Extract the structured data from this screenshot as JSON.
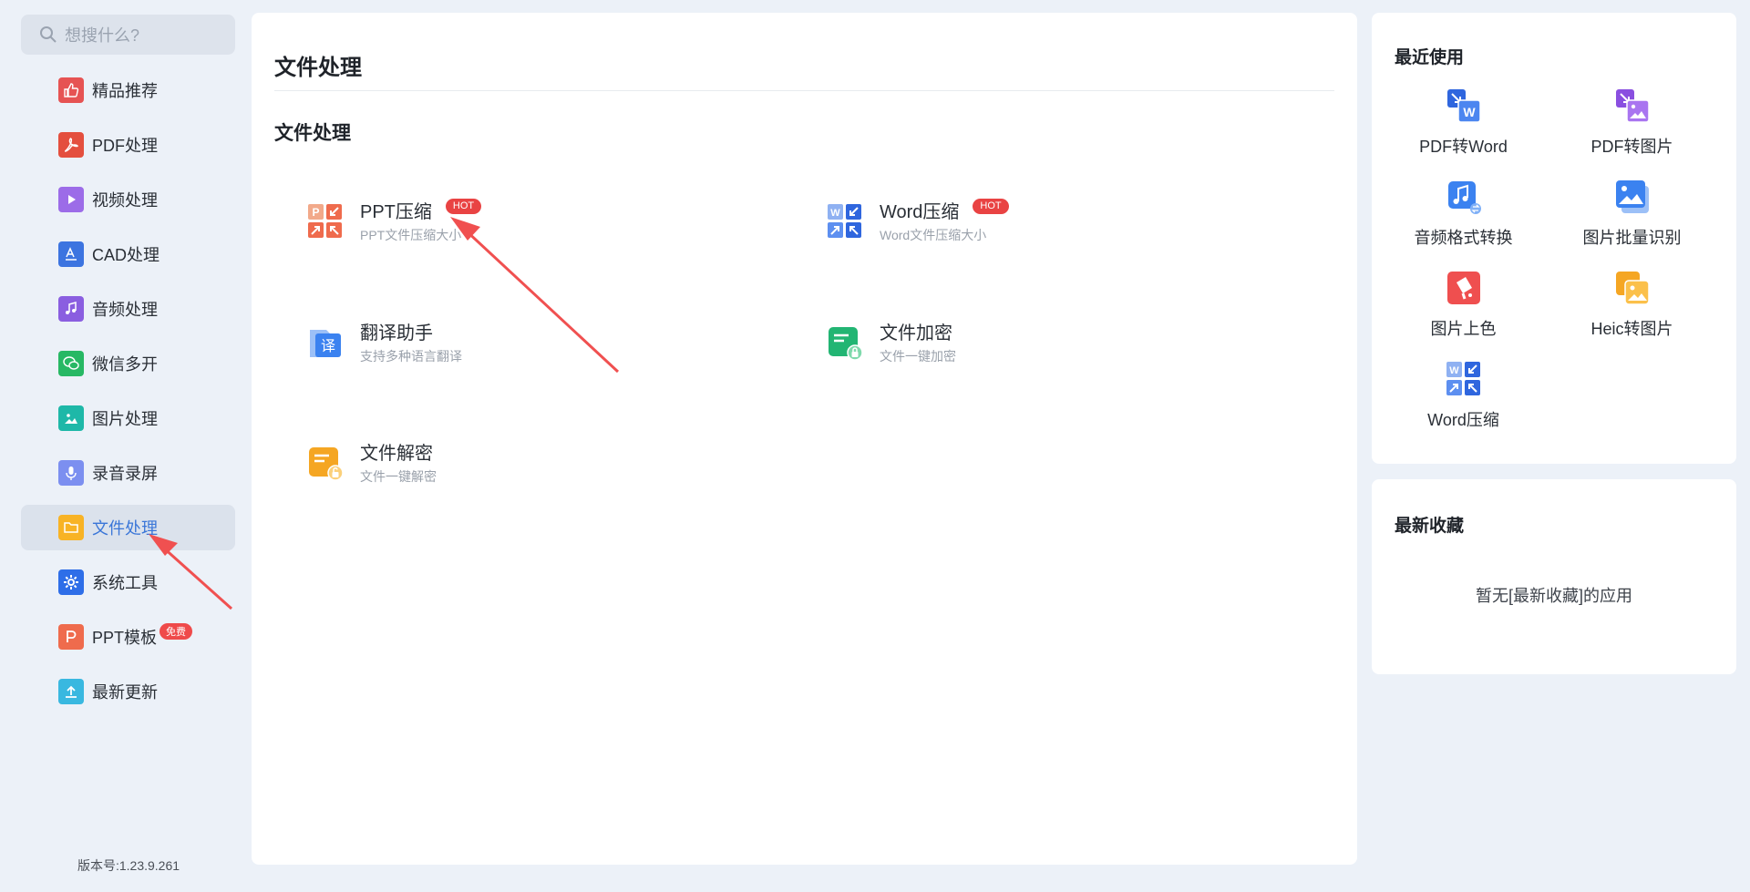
{
  "search": {
    "placeholder": "想搜什么?"
  },
  "sidebar": {
    "items": [
      {
        "label": "精品推荐",
        "icon": "thumb-up-icon",
        "color": "#e65353"
      },
      {
        "label": "PDF处理",
        "icon": "pdf-icon",
        "color": "#e44f3e"
      },
      {
        "label": "视频处理",
        "icon": "play-icon",
        "color": "#9c6ce8"
      },
      {
        "label": "CAD处理",
        "icon": "cad-icon",
        "color": "#3c74e0"
      },
      {
        "label": "音频处理",
        "icon": "music-icon",
        "color": "#8a5ee0"
      },
      {
        "label": "微信多开",
        "icon": "wechat-icon",
        "color": "#27b864"
      },
      {
        "label": "图片处理",
        "icon": "image-icon",
        "color": "#1eb8a8"
      },
      {
        "label": "录音录屏",
        "icon": "mic-icon",
        "color": "#7c8ff0"
      },
      {
        "label": "文件处理",
        "icon": "folder-icon",
        "color": "#f8b325"
      },
      {
        "label": "系统工具",
        "icon": "gear-icon",
        "color": "#2e6ee8"
      },
      {
        "label": "PPT模板",
        "icon": "ppt-icon",
        "color": "#ef6b4d",
        "badge": "免费"
      },
      {
        "label": "最新更新",
        "icon": "upload-icon",
        "color": "#39b8e0"
      }
    ],
    "active_index": 8
  },
  "version": "版本号:1.23.9.261",
  "main": {
    "title": "文件处理",
    "section_title": "文件处理",
    "tools": [
      {
        "name": "PPT压缩",
        "desc": "PPT文件压缩大小",
        "badge": "HOT",
        "icon": "ppt-compress-icon"
      },
      {
        "name": "Word压缩",
        "desc": "Word文件压缩大小",
        "badge": "HOT",
        "icon": "word-compress-icon"
      },
      {
        "name": "翻译助手",
        "desc": "支持多种语言翻译",
        "icon": "translate-icon"
      },
      {
        "name": "文件加密",
        "desc": "文件一键加密",
        "icon": "file-encrypt-icon"
      },
      {
        "name": "文件解密",
        "desc": "文件一键解密",
        "icon": "file-decrypt-icon"
      }
    ]
  },
  "recent": {
    "title": "最近使用",
    "apps": [
      {
        "label": "PDF转Word",
        "icon": "pdf-to-word-icon"
      },
      {
        "label": "PDF转图片",
        "icon": "pdf-to-image-icon"
      },
      {
        "label": "音频格式转换",
        "icon": "audio-convert-icon"
      },
      {
        "label": "图片批量识别",
        "icon": "image-recognize-icon"
      },
      {
        "label": "图片上色",
        "icon": "image-colorize-icon"
      },
      {
        "label": "Heic转图片",
        "icon": "heic-to-image-icon"
      },
      {
        "label": "Word压缩",
        "icon": "word-compress-icon"
      }
    ]
  },
  "favorites": {
    "title": "最新收藏",
    "empty_text": "暂无[最新收藏]的应用"
  },
  "colors": {
    "accent": "#3a76d8",
    "hot": "#e94343",
    "arrow": "#f05050"
  }
}
